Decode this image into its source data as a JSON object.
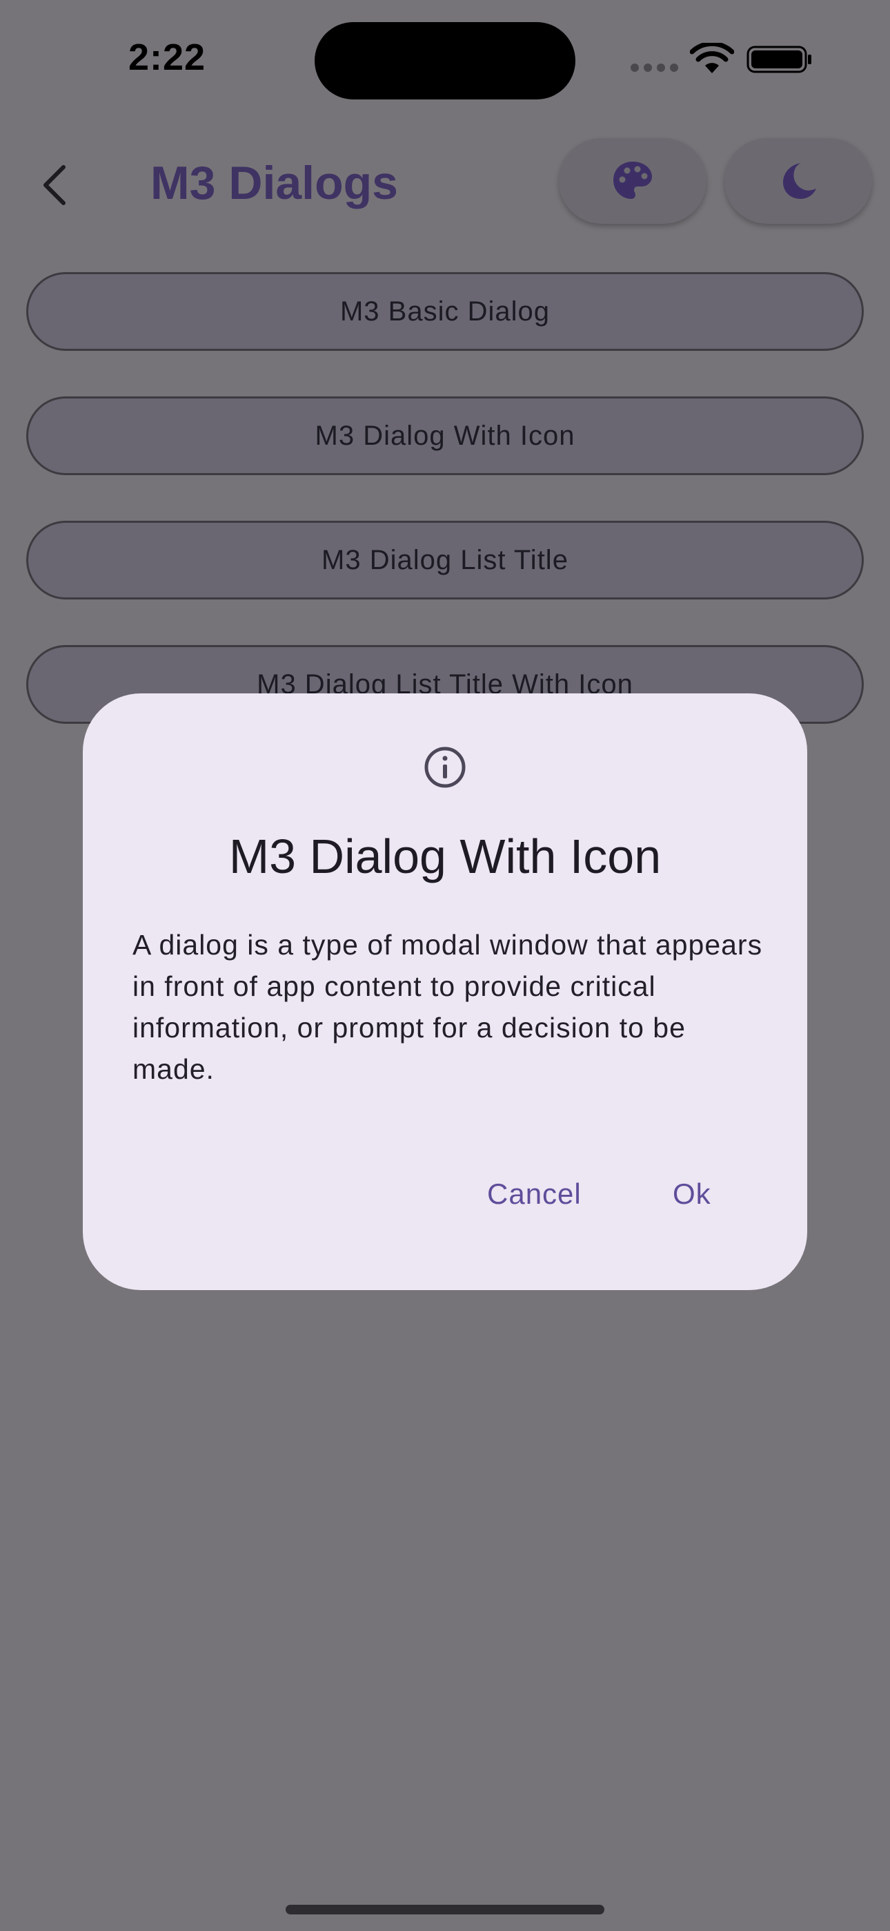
{
  "status_bar": {
    "time": "2:22"
  },
  "app_bar": {
    "title": "M3 Dialogs",
    "back_icon": "chevron-left-icon",
    "palette_icon": "palette-icon",
    "theme_icon": "moon-icon"
  },
  "buttons": [
    {
      "label": "M3 Basic Dialog"
    },
    {
      "label": "M3 Dialog With Icon"
    },
    {
      "label": "M3 Dialog List Title"
    },
    {
      "label": "M3 Dialog List Title With Icon"
    }
  ],
  "dialog": {
    "icon": "info-icon",
    "title": "M3 Dialog With Icon",
    "body": "A dialog is a type of modal window that appears in front of app content to provide critical information, or prompt for a decision to be made.",
    "cancel_label": "Cancel",
    "ok_label": "Ok"
  },
  "colors": {
    "scrim": "#777479",
    "dialog_surface": "#ede6f3",
    "primary": "#5e4d9a",
    "title": "#3f3363"
  }
}
